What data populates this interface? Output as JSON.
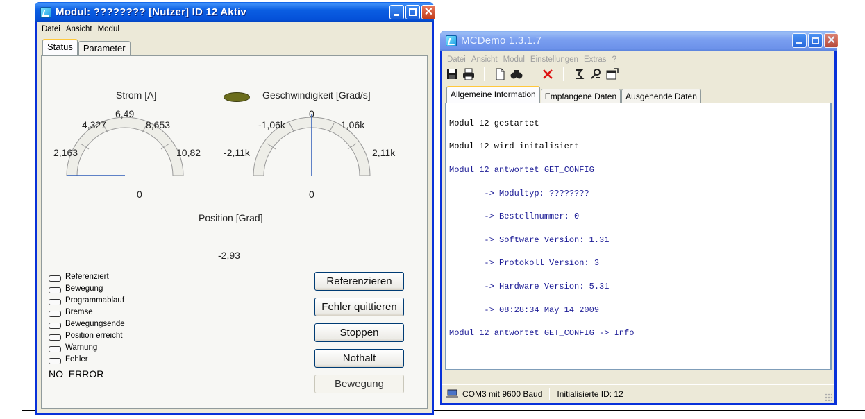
{
  "left_window": {
    "title": "Modul: ???????? [Nutzer] ID 12 Aktiv",
    "menu": [
      "Datei",
      "Ansicht",
      "Modul"
    ],
    "tabs": [
      "Status",
      "Parameter"
    ],
    "strom_gauge": {
      "label": "Strom [A]",
      "ticks": [
        "0",
        "2,163",
        "4,327",
        "6,49",
        "8,653",
        "10,82"
      ],
      "value": 0
    },
    "speed_gauge": {
      "label": "Geschwindigkeit [Grad/s]",
      "ticks": [
        "0",
        "-2,11k",
        "-1,06k",
        "0",
        "1,06k",
        "2,11k"
      ],
      "value": 0
    },
    "position_label": "Position [Grad]",
    "position_value": "-2,93",
    "indicators": [
      "Referenziert",
      "Bewegung",
      "Programmablauf",
      "Bremse",
      "Bewegungsende",
      "Position erreicht",
      "Warnung",
      "Fehler"
    ],
    "buttons": [
      "Referenzieren",
      "Fehler quittieren",
      "Stoppen",
      "Nothalt",
      "Bewegung"
    ],
    "error_text": "NO_ERROR",
    "colors": {
      "led": "#6b6d1c",
      "needle": "#2d5bb8"
    }
  },
  "right_window": {
    "title": "MCDemo 1.3.1.7",
    "menu": [
      "Datei",
      "Ansicht",
      "Modul",
      "Einstellungen",
      "Extras",
      "?"
    ],
    "toolbar_icons": [
      "save-icon",
      "print-icon",
      "new-document-icon",
      "find-icon",
      "delete-icon",
      "connect-icon",
      "tools-icon",
      "properties-icon"
    ],
    "tabs": [
      "Allgemeine Information",
      "Empfangene Daten",
      "Ausgehende Daten"
    ],
    "log": [
      "Modul 12 gestartet",
      "Modul 12 wird initalisiert",
      "Modul 12 antwortet GET_CONFIG",
      "       -> Modultyp: ????????",
      "       -> Bestellnummer: 0",
      "       -> Software Version: 1.31",
      "       -> Protokoll Version: 3",
      "       -> Hardware Version: 5.31",
      "       -> 08:28:34 May 14 2009",
      "Modul 12 antwortet GET_CONFIG -> Info"
    ],
    "status": {
      "connection": "COM3 mit 9600 Baud",
      "id": "Initialisierte ID: 12"
    }
  }
}
